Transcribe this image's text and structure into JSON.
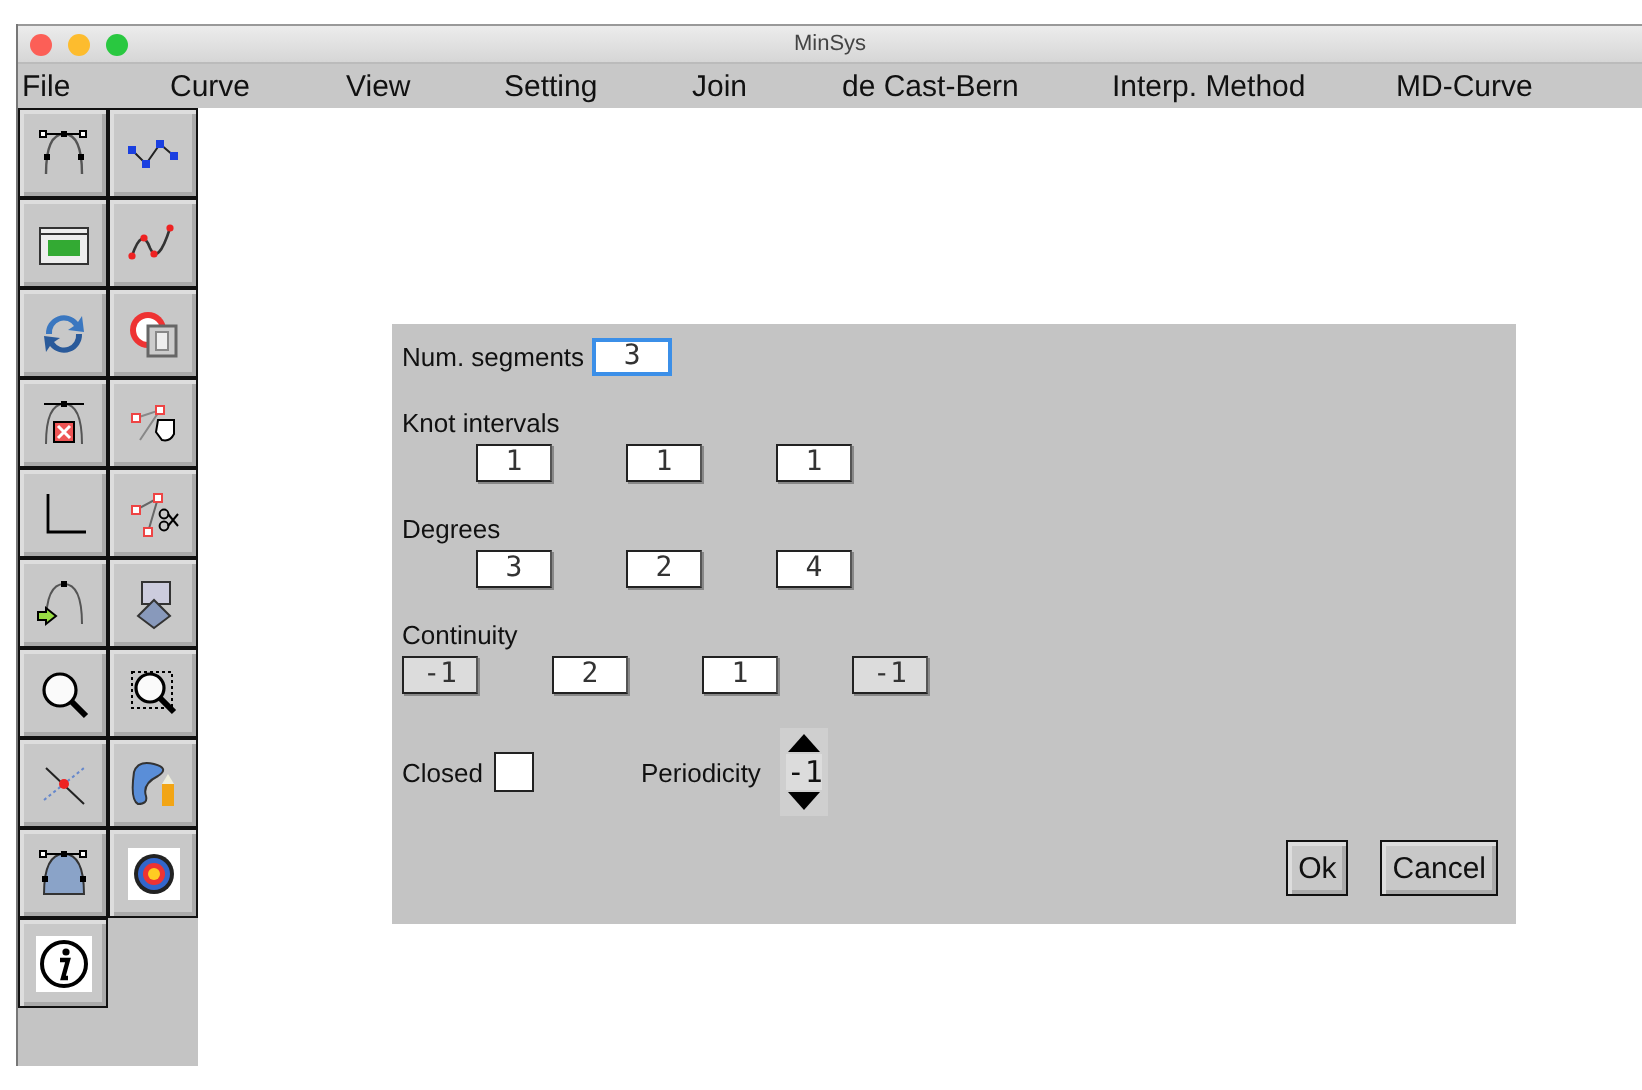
{
  "window": {
    "title": "MinSys"
  },
  "menu": [
    "File",
    "Curve",
    "View",
    "Setting",
    "Join",
    "de Cast-Bern",
    "Interp. Method",
    "MD-Curve"
  ],
  "dialog": {
    "num_segments": {
      "label": "Num. segments",
      "value": "3",
      "focused": true
    },
    "knot_intervals": {
      "label": "Knot intervals",
      "values": [
        "1",
        "1",
        "1"
      ]
    },
    "degrees": {
      "label": "Degrees",
      "values": [
        "3",
        "2",
        "4"
      ]
    },
    "continuity": {
      "label": "Continuity",
      "fields": [
        {
          "value": "-1",
          "disabled": true
        },
        {
          "value": "2",
          "disabled": false
        },
        {
          "value": "1",
          "disabled": false
        },
        {
          "value": "-1",
          "disabled": true
        }
      ]
    },
    "closed": {
      "label": "Closed",
      "checked": false
    },
    "periodicity": {
      "label": "Periodicity",
      "value": "-1"
    },
    "buttons": [
      "Ok",
      "Cancel"
    ]
  }
}
